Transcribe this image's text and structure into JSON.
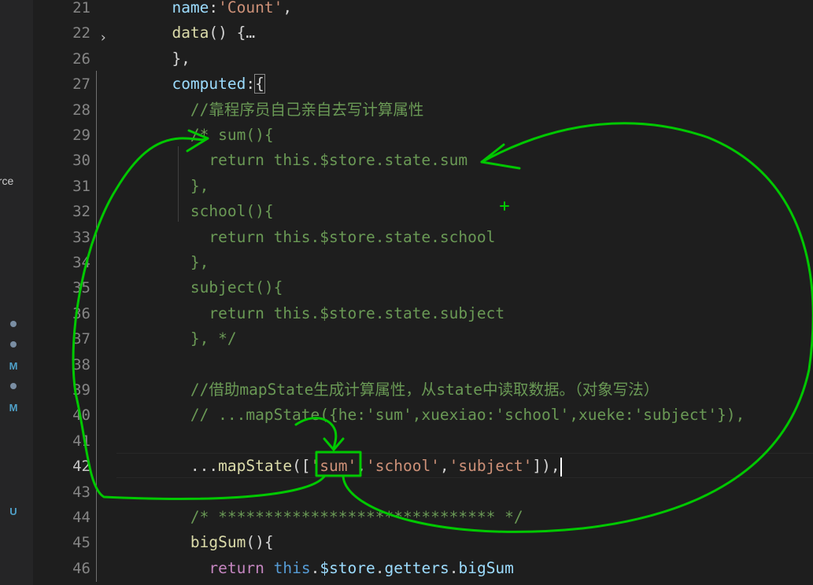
{
  "sidebar": {
    "cut_label": "urce",
    "markers": [
      {
        "type": "dot",
        "color": "#7a8ea3"
      },
      {
        "type": "dot",
        "color": "#7a8ea3"
      },
      {
        "type": "badge",
        "text": "M",
        "color": "#4fa0c8"
      },
      {
        "type": "dot",
        "color": "#7a8ea3"
      },
      {
        "type": "badge",
        "text": "M",
        "color": "#4fa0c8"
      },
      {
        "type": "badge",
        "text": "U",
        "color": "#4fa0c8"
      }
    ]
  },
  "editor": {
    "active_line": "42",
    "line_numbers": [
      "21",
      "22",
      "26",
      "27",
      "28",
      "29",
      "30",
      "31",
      "32",
      "33",
      "34",
      "35",
      "36",
      "37",
      "38",
      "39",
      "40",
      "41",
      "42",
      "43",
      "44",
      "45",
      "46"
    ],
    "lines": [
      [
        {
          "t": "      "
        },
        {
          "t": "name",
          "c": "prop"
        },
        {
          "t": ":"
        },
        {
          "t": "'Count'",
          "c": "str"
        },
        {
          "t": ","
        }
      ],
      [
        {
          "t": "      "
        },
        {
          "t": "data",
          "c": "fn"
        },
        {
          "t": "() {"
        },
        {
          "t": "…"
        }
      ],
      [
        {
          "t": "      },"
        }
      ],
      [
        {
          "t": "      "
        },
        {
          "t": "computed",
          "c": "prop"
        },
        {
          "t": ":"
        },
        {
          "t": "{",
          "c": "brace"
        }
      ],
      [
        {
          "t": "        "
        },
        {
          "t": "//靠程序员自己亲自去写计算属性",
          "c": "comment"
        }
      ],
      [
        {
          "t": "        "
        },
        {
          "t": "/* sum(){",
          "c": "comment"
        }
      ],
      [
        {
          "t": "          "
        },
        {
          "t": "return this.$store.state.sum",
          "c": "comment"
        }
      ],
      [
        {
          "t": "        "
        },
        {
          "t": "},",
          "c": "comment"
        }
      ],
      [
        {
          "t": "        "
        },
        {
          "t": "school(){",
          "c": "comment"
        }
      ],
      [
        {
          "t": "          "
        },
        {
          "t": "return this.$store.state.school",
          "c": "comment"
        }
      ],
      [
        {
          "t": "        "
        },
        {
          "t": "},",
          "c": "comment"
        }
      ],
      [
        {
          "t": "        "
        },
        {
          "t": "subject(){",
          "c": "comment"
        }
      ],
      [
        {
          "t": "          "
        },
        {
          "t": "return this.$store.state.subject",
          "c": "comment"
        }
      ],
      [
        {
          "t": "        "
        },
        {
          "t": "}, */",
          "c": "comment"
        }
      ],
      [
        {
          "t": ""
        }
      ],
      [
        {
          "t": "        "
        },
        {
          "t": "//借助mapState生成计算属性，从state中读取数据。（对象写法）",
          "c": "comment"
        }
      ],
      [
        {
          "t": "        "
        },
        {
          "t": "// ...mapState({he:'sum',xuexiao:'school',xueke:'subject'}),",
          "c": "comment"
        }
      ],
      [
        {
          "t": ""
        }
      ],
      [
        {
          "t": "        ..."
        },
        {
          "t": "mapState",
          "c": "fn"
        },
        {
          "t": "(["
        },
        {
          "t": "'sum'",
          "c": "str"
        },
        {
          "t": ","
        },
        {
          "t": "'school'",
          "c": "str"
        },
        {
          "t": ","
        },
        {
          "t": "'subject'",
          "c": "str"
        },
        {
          "t": "]),"
        },
        {
          "t": "",
          "c": "cursor"
        }
      ],
      [
        {
          "t": ""
        }
      ],
      [
        {
          "t": "        "
        },
        {
          "t": "/* ****************************** */",
          "c": "comment"
        }
      ],
      [
        {
          "t": "        "
        },
        {
          "t": "bigSum",
          "c": "fn"
        },
        {
          "t": "(){"
        }
      ],
      [
        {
          "t": "          "
        },
        {
          "t": "return",
          "c": "kw"
        },
        {
          "t": " "
        },
        {
          "t": "this",
          "c": "this"
        },
        {
          "t": "."
        },
        {
          "t": "$store",
          "c": "prop"
        },
        {
          "t": "."
        },
        {
          "t": "getters",
          "c": "prop"
        },
        {
          "t": "."
        },
        {
          "t": "bigSum",
          "c": "prop"
        }
      ]
    ]
  },
  "annotations": {
    "ink_color": "#00c800"
  }
}
